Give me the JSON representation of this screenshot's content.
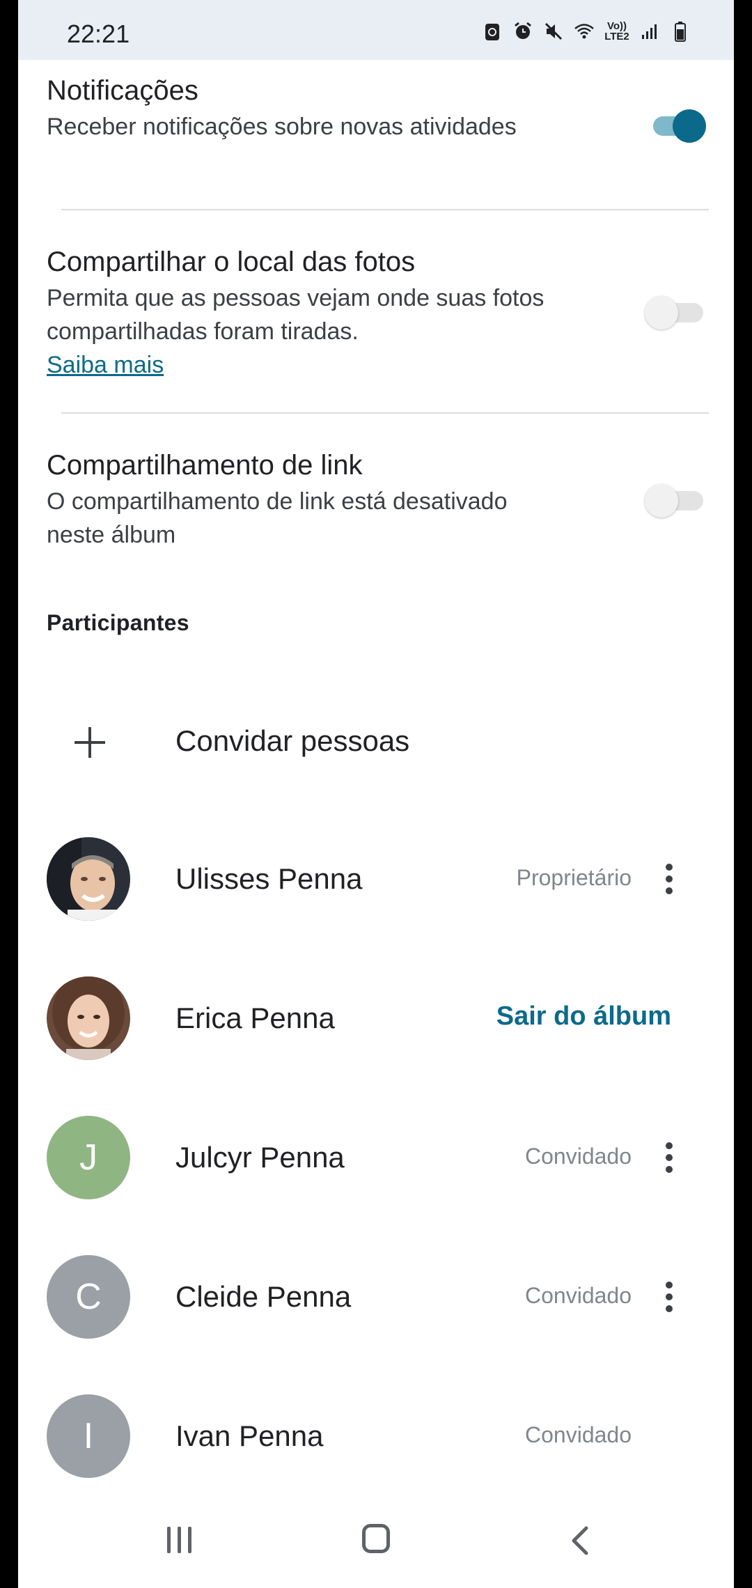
{
  "status_bar": {
    "time": "22:21",
    "icons": [
      "battery-saver-icon",
      "alarm-icon",
      "mute-icon",
      "wifi-icon",
      "volte-icon",
      "signal-icon",
      "battery-icon"
    ],
    "volte_line1": "Vo))",
    "volte_line2": "LTE2"
  },
  "settings": {
    "notifications": {
      "title": "Notificações",
      "description": "Receber notificações sobre novas atividades",
      "enabled": true
    },
    "share_location": {
      "title": "Compartilhar o local das fotos",
      "description": "Permita que as pessoas vejam onde suas fotos compartilhadas foram tiradas.",
      "link": "Saiba mais",
      "enabled": false
    },
    "link_sharing": {
      "title": "Compartilhamento de link",
      "description": "O compartilhamento de link está desativado neste álbum",
      "enabled": false
    }
  },
  "participants": {
    "header": "Participantes",
    "invite_label": "Convidar pessoas",
    "people": [
      {
        "name": "Ulisses Penna",
        "role": "Proprietário",
        "avatar": "photo"
      },
      {
        "name": "Erica Penna",
        "action": "Sair do álbum",
        "avatar": "photo"
      },
      {
        "name": "Julcyr Penna",
        "role": "Convidado",
        "initial": "J",
        "avatar_color": "#8fb583"
      },
      {
        "name": "Cleide Penna",
        "role": "Convidado",
        "initial": "C",
        "avatar_color": "#9aa0a6"
      },
      {
        "name": "Ivan Penna",
        "role": "Convidado",
        "initial": "I",
        "avatar_color": "#9aa0a6"
      }
    ]
  },
  "colors": {
    "accent": "#0b6a8b",
    "toggle_on_track": "#7fb8ca"
  },
  "nav_bar": {
    "icons": [
      "recent-apps-icon",
      "home-icon",
      "back-icon"
    ]
  }
}
